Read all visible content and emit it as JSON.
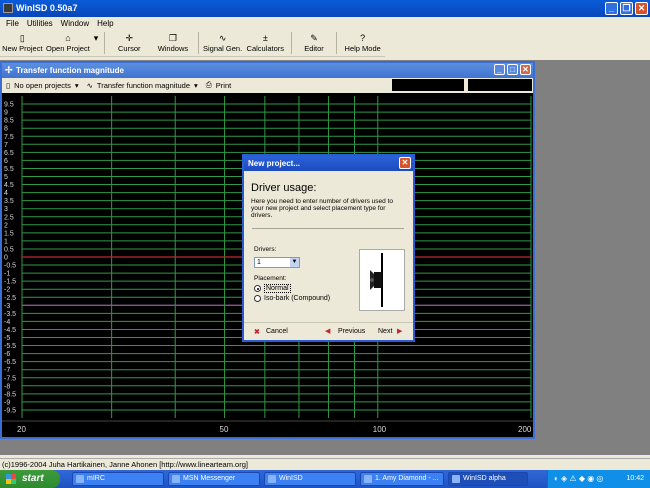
{
  "app": {
    "title": "WinISD 0.50a7"
  },
  "menu": [
    "File",
    "Utilities",
    "Window",
    "Help"
  ],
  "toolbar": {
    "items": [
      {
        "label": "New Project",
        "icon": "new-project-icon"
      },
      {
        "label": "Open Project",
        "icon": "open-project-icon"
      },
      {
        "label": "Cursor",
        "icon": "cursor-icon"
      },
      {
        "label": "Windows",
        "icon": "windows-icon"
      },
      {
        "label": "Signal Gen.",
        "icon": "signal-gen-icon"
      },
      {
        "label": "Calculators",
        "icon": "calculators-icon"
      },
      {
        "label": "Editor",
        "icon": "editor-icon"
      },
      {
        "label": "Help Mode",
        "icon": "help-mode-icon"
      }
    ]
  },
  "child": {
    "title": "Transfer function magnitude",
    "projects_dropdown": "No open projects",
    "graph_dropdown": "Transfer function magnitude",
    "print_label": "Print"
  },
  "chart_data": {
    "type": "line",
    "title": "",
    "xlabel": "",
    "ylabel": "",
    "x_scale": "log",
    "xlim": [
      20,
      200
    ],
    "ylim": [
      -10,
      10
    ],
    "x_tick_labels": [
      "20",
      "50",
      "100",
      "200"
    ],
    "y_tick_labels": [
      "9.5",
      "9",
      "8.5",
      "8",
      "7.5",
      "7",
      "6.5",
      "6",
      "5.5",
      "5",
      "4.5",
      "4",
      "3.5",
      "3",
      "2.5",
      "2",
      "1.5",
      "1",
      "0.5",
      "0",
      "-0.5",
      "-1",
      "-1.5",
      "-2",
      "-2.5",
      "-3",
      "-3.5",
      "-4",
      "-4.5",
      "-5",
      "-5.5",
      "-6",
      "-6.5",
      "-7",
      "-7.5",
      "-8",
      "-8.5",
      "-9",
      "-9.5"
    ],
    "grid": true,
    "reference_lines": [
      {
        "y": 0,
        "color": "#c0282e"
      },
      {
        "y": -3,
        "color": "#c03ac0"
      }
    ],
    "series": [],
    "colors": {
      "background": "#000000",
      "grid": "#2f9a46"
    }
  },
  "dialog": {
    "title": "New project...",
    "heading": "Driver usage:",
    "description": "Here you need to enter number of drivers used to your new project and select placement type for drivers.",
    "drivers_label": "Drivers:",
    "drivers_value": "1",
    "placement_label": "Placement:",
    "placement_options": [
      "Normal",
      "Iso-bark (Compound)"
    ],
    "cancel_label": "Cancel",
    "previous_label": "Previous",
    "next_label": "Next"
  },
  "status_bar": {
    "text": "(c)1996-2004 Juha Hartikainen, Janne Ahonen [http://www.linearteam.org]"
  },
  "taskbar": {
    "start_label": "start",
    "buttons": [
      "mIRC",
      "MSN Messenger",
      "WinISD",
      "1. Amy Diamond - ...",
      "WinISD alpha"
    ],
    "clock": "10:42"
  }
}
